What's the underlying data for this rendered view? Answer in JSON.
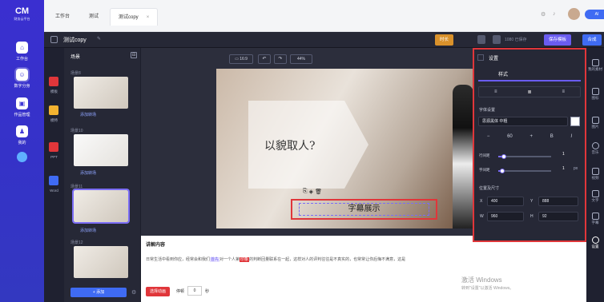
{
  "rail": {
    "logo": "CM",
    "logo_sub": "财务云平台",
    "items": [
      {
        "label": "工作台",
        "icon": "home-icon"
      },
      {
        "label": "数字分身",
        "icon": "avatar-icon"
      },
      {
        "label": "作品管理",
        "icon": "works-icon"
      },
      {
        "label": "我的",
        "icon": "user-icon"
      }
    ]
  },
  "editor_rail": [
    {
      "label": "模板"
    },
    {
      "label": "模特"
    },
    {
      "label": "PPT"
    },
    {
      "label": "Word"
    }
  ],
  "tabs": [
    {
      "label": "工作台"
    },
    {
      "label": "测试"
    },
    {
      "label": "测试copy",
      "close": "×"
    }
  ],
  "topbar_right": {
    "user_badge": "AI"
  },
  "toolbar": {
    "project_name": "测试copy",
    "rename_icon": "pencil-icon",
    "ratio_label": "16:9",
    "zoom": "44%",
    "timeline_btn": "时长",
    "resolution": "1080 已保存",
    "save_template": "保存模板",
    "compose": "合成"
  },
  "scenes": {
    "header": "场景",
    "items": [
      {
        "label": "场景8",
        "add": "添加转场"
      },
      {
        "label": "场景10",
        "add": "添加转场"
      },
      {
        "label": "场景11",
        "add": "添加转场"
      },
      {
        "label": "场景12",
        "add": ""
      }
    ],
    "add_button": "+ 添加"
  },
  "canvas": {
    "main_title": "以貌取人?",
    "subtitle": "字幕展示"
  },
  "narration": {
    "header": "讲解内容",
    "text_before": "日常生活中看到你应，经常会和我们",
    "highlight1": "首先",
    "text_mid": "对一个人第",
    "highlight2": "印象",
    "text_after": "的判断回量联系在一起，这样对人的评判往往是不真实的，也常常让你后悔不满意，这是",
    "button": "选择动画",
    "pause_label": "停顿",
    "pause_value": "0",
    "pause_unit": "秒"
  },
  "panel": {
    "title": "设置",
    "tab_style": "样式",
    "font_section": "字体设置",
    "font_name": "思源黑体 中粗",
    "font_size": "60",
    "bold": "B",
    "italic": "I",
    "line_spacing_label": "行间距",
    "line_spacing_value": "1",
    "letter_spacing_label": "字间距",
    "letter_spacing_value": "1",
    "letter_spacing_unit": "px",
    "pos_section": "位置及尺寸",
    "x_label": "X",
    "x_value": "400",
    "y_label": "Y",
    "y_value": "888",
    "w_label": "W",
    "w_value": "960",
    "h_label": "H",
    "h_value": "92",
    "line_spacing_level": 0.1,
    "letter_spacing_level": 0.08
  },
  "far_right": [
    {
      "label": "我的素材"
    },
    {
      "label": "图标"
    },
    {
      "label": "图片"
    },
    {
      "label": "音乐"
    },
    {
      "label": "视频"
    },
    {
      "label": "文字"
    },
    {
      "label": "字幕"
    },
    {
      "label": "设置"
    }
  ],
  "watermark": {
    "line1": "激活 Windows",
    "line2": "转到\"设置\"以激活 Windows。"
  },
  "colors": {
    "accent": "#7b6df6",
    "rail": "#3a33cf",
    "highlight_red": "#e0363a"
  }
}
